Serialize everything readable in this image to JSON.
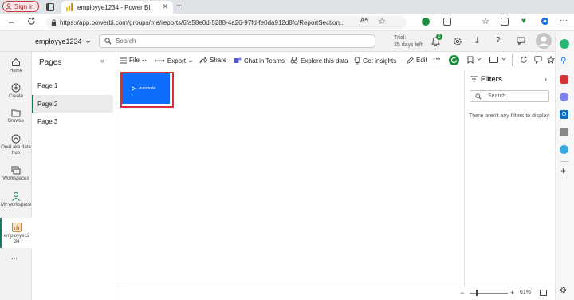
{
  "browser": {
    "sign_in": "Sign in",
    "tab_title": "employye1234 - Power BI",
    "url": "https://app.powerbi.com/groups/me/reports/6fa58e0d-5288-4a26-97fd-fe0da912d8fc/ReportSection..."
  },
  "header": {
    "workspace": "employye1234",
    "search_placeholder": "Search",
    "trial_line1": "Trial:",
    "trial_line2": "25 days left",
    "notification_count": "2"
  },
  "nav": {
    "items": [
      {
        "label": "Home"
      },
      {
        "label": "Create"
      },
      {
        "label": "Browse"
      },
      {
        "label": "OneLake data hub"
      },
      {
        "label": "Workspaces"
      },
      {
        "label": "My workspace"
      },
      {
        "label": "employye12 34"
      }
    ],
    "more": "..."
  },
  "pages_pane": {
    "title": "Pages",
    "collapse": "«",
    "items": [
      {
        "label": "Page 1"
      },
      {
        "label": "Page 2"
      },
      {
        "label": "Page 3"
      }
    ]
  },
  "toolbar": {
    "file": "File",
    "export": "Export",
    "share": "Share",
    "chat": "Chat in Teams",
    "explore": "Explore this data",
    "insights": "Get insights",
    "edit": "Edit",
    "more": "···"
  },
  "canvas": {
    "automate_label": "Automate"
  },
  "filters": {
    "title": "Filters",
    "search_placeholder": "Search",
    "empty_text": "There aren't any filters to display."
  },
  "statusbar": {
    "zoom": "61%"
  },
  "colors": {
    "accent": "#117865",
    "automate_button": "#0d6efd",
    "highlight": "#d13438"
  }
}
